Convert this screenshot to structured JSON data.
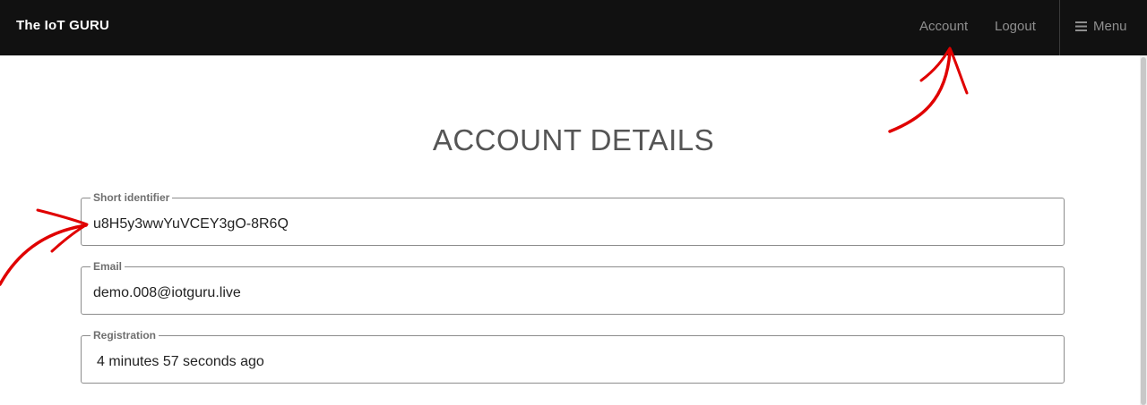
{
  "header": {
    "brand": "The IoT GURU",
    "nav": {
      "account": "Account",
      "logout": "Logout",
      "menu": "Menu"
    }
  },
  "main": {
    "title": "ACCOUNT DETAILS",
    "fields": [
      {
        "label": "Short identifier",
        "value": "u8H5y3wwYuVCEY3gO-8R6Q"
      },
      {
        "label": "Email",
        "value": "demo.008@iotguru.live"
      },
      {
        "label": "Registration",
        "value": "4 minutes 57 seconds ago"
      }
    ]
  },
  "colors": {
    "topbar": "#111111",
    "nav_text": "#8f8f8f",
    "annotation_arrow": "#e00000"
  },
  "icons": {
    "menu": "hamburger-icon"
  }
}
